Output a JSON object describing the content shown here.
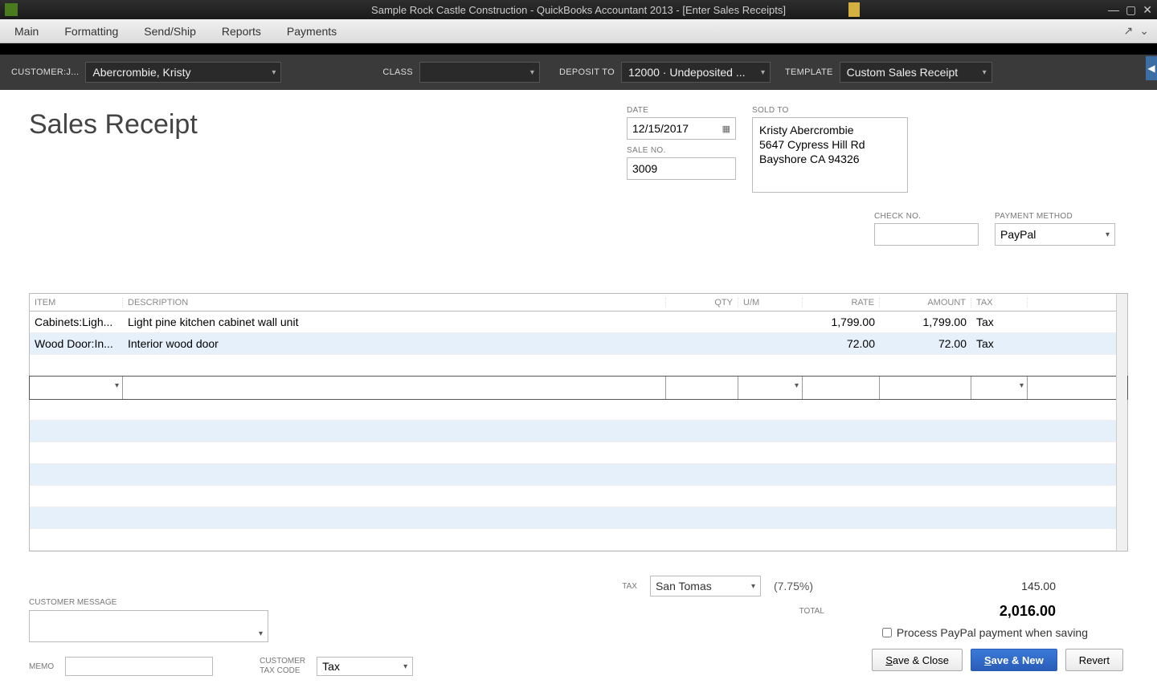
{
  "titlebar": {
    "title": "Sample Rock Castle Construction  - QuickBooks Accountant 2013 - [Enter Sales Receipts]"
  },
  "menubar": {
    "items": [
      "Main",
      "Formatting",
      "Send/Ship",
      "Reports",
      "Payments"
    ]
  },
  "darkbar": {
    "customer_label": "CUSTOMER:J...",
    "customer_value": "Abercrombie, Kristy",
    "class_label": "CLASS",
    "class_value": "",
    "deposit_label": "DEPOSIT TO",
    "deposit_value": "12000 · Undeposited ...",
    "template_label": "TEMPLATE",
    "template_value": "Custom Sales Receipt"
  },
  "receipt": {
    "title": "Sales Receipt",
    "date_label": "DATE",
    "date": "12/15/2017",
    "saleno_label": "SALE NO.",
    "saleno": "3009",
    "soldto_label": "SOLD TO",
    "soldto_line1": "Kristy Abercrombie",
    "soldto_line2": "5647 Cypress Hill Rd",
    "soldto_line3": "Bayshore CA 94326",
    "checkno_label": "CHECK NO.",
    "checkno": "",
    "paymethod_label": "PAYMENT METHOD",
    "paymethod": "PayPal"
  },
  "table": {
    "headers": {
      "item": "ITEM",
      "desc": "DESCRIPTION",
      "qty": "QTY",
      "um": "U/M",
      "rate": "RATE",
      "amount": "AMOUNT",
      "tax": "TAX"
    },
    "rows": [
      {
        "item": "Cabinets:Ligh...",
        "desc": "Light pine kitchen cabinet wall unit",
        "qty": "",
        "um": "",
        "rate": "1,799.00",
        "amount": "1,799.00",
        "tax": "Tax"
      },
      {
        "item": "Wood Door:In...",
        "desc": "Interior wood door",
        "qty": "",
        "um": "",
        "rate": "72.00",
        "amount": "72.00",
        "tax": "Tax"
      }
    ]
  },
  "totals": {
    "tax_label": "TAX",
    "tax_name": "San Tomas",
    "tax_rate": "(7.75%)",
    "tax_amount": "145.00",
    "total_label": "TOTAL",
    "total_amount": "2,016.00"
  },
  "bottom": {
    "custmsg_label": "CUSTOMER MESSAGE",
    "memo_label": "MEMO",
    "taxcode_label1": "CUSTOMER",
    "taxcode_label2": "TAX CODE",
    "taxcode_value": "Tax",
    "process_label": "Process PayPal payment when saving",
    "save_close": "ave & Close",
    "save_close_key": "S",
    "save_new": "ave & New",
    "save_new_key": "S",
    "revert": "Revert"
  }
}
